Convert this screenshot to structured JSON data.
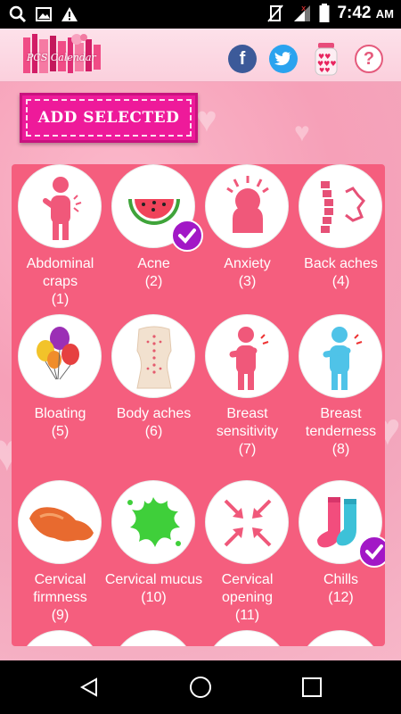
{
  "status_bar": {
    "time": "7:42",
    "ampm": "AM"
  },
  "app": {
    "logo_text": "PCS Calendar"
  },
  "toolbar": {
    "add_selected_label": "ADD SELECTED"
  },
  "symptoms": [
    {
      "name": "Abdominal craps",
      "count": "(1)",
      "icon": "abdominal-figure-icon",
      "selected": false
    },
    {
      "name": "Acne",
      "count": "(2)",
      "icon": "watermelon-icon",
      "selected": true
    },
    {
      "name": "Anxiety",
      "count": "(3)",
      "icon": "anxiety-head-icon",
      "selected": false
    },
    {
      "name": "Back aches",
      "count": "(4)",
      "icon": "spine-icon",
      "selected": false
    },
    {
      "name": "Bloating",
      "count": "(5)",
      "icon": "balloons-icon",
      "selected": false
    },
    {
      "name": "Body aches",
      "count": "(6)",
      "icon": "body-torso-icon",
      "selected": false
    },
    {
      "name": "Breast sensitivity",
      "count": "(7)",
      "icon": "breast-figure-pink-icon",
      "selected": false
    },
    {
      "name": "Breast tenderness",
      "count": "(8)",
      "icon": "breast-figure-blue-icon",
      "selected": false
    },
    {
      "name": "Cervical firmness",
      "count": "(9)",
      "icon": "orange-shape-icon",
      "selected": false
    },
    {
      "name": "Cervical mucus",
      "count": "(10)",
      "icon": "green-splat-icon",
      "selected": false
    },
    {
      "name": "Cervical opening",
      "count": "(11)",
      "icon": "arrows-inward-icon",
      "selected": false
    },
    {
      "name": "Chills",
      "count": "(12)",
      "icon": "socks-icon",
      "selected": true
    }
  ],
  "colors": {
    "panel": "#f55e7e",
    "button": "#ee1a9a",
    "check": "#a218c6",
    "icon_pink": "#f0587a"
  }
}
